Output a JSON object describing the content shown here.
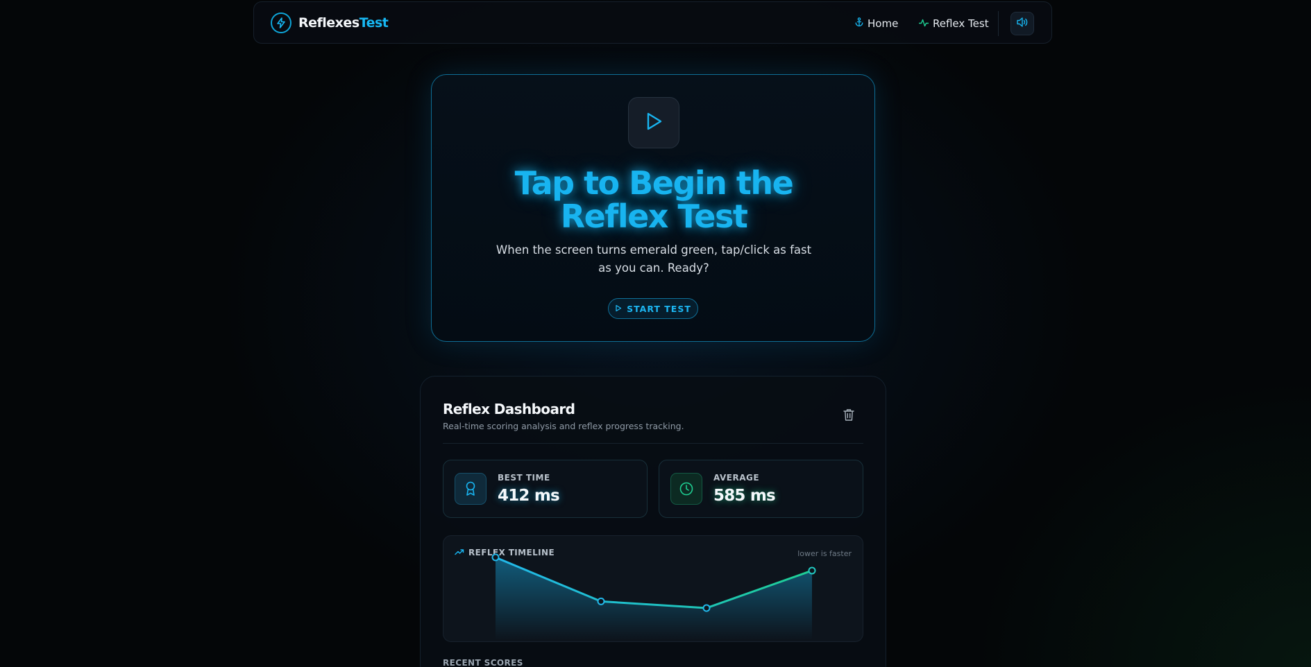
{
  "nav": {
    "brand_primary": "Reflexes",
    "brand_accent": "Test",
    "home_label": "Home",
    "reflex_label": "Reflex Test"
  },
  "hero": {
    "title": "Tap to Begin the Reflex Test",
    "subtitle": "When the screen turns emerald green, tap/click as fast as you can. Ready?",
    "start_label": "START TEST"
  },
  "dashboard": {
    "title": "Reflex Dashboard",
    "subtitle": "Real-time scoring analysis and reflex progress tracking.",
    "best_label": "BEST TIME",
    "best_value": "412 ms",
    "avg_label": "AVERAGE",
    "avg_value": "585 ms",
    "timeline_label": "REFLEX TIMELINE",
    "timeline_hint": "lower is faster",
    "recent_label": "RECENT SCORES"
  },
  "colors": {
    "accent_blue": "#18b4f0",
    "accent_green": "#1fcf93",
    "background": "#040608"
  },
  "icons": {
    "brand": "lightning-bolt-icon",
    "home": "anchor-icon",
    "reflex": "activity-icon",
    "sound": "volume-icon",
    "play": "play-icon",
    "trash": "trash-icon",
    "best": "award-icon",
    "average": "clock-icon",
    "timeline": "trending-up-icon"
  },
  "chart_data": {
    "type": "line",
    "title": "REFLEX TIMELINE",
    "ylabel": "",
    "xlabel": "",
    "x": [
      1,
      2,
      3,
      4
    ],
    "ylim": [
      380,
      720
    ],
    "series": [
      {
        "values": [
          680,
          520,
          496,
          632
        ]
      }
    ]
  }
}
